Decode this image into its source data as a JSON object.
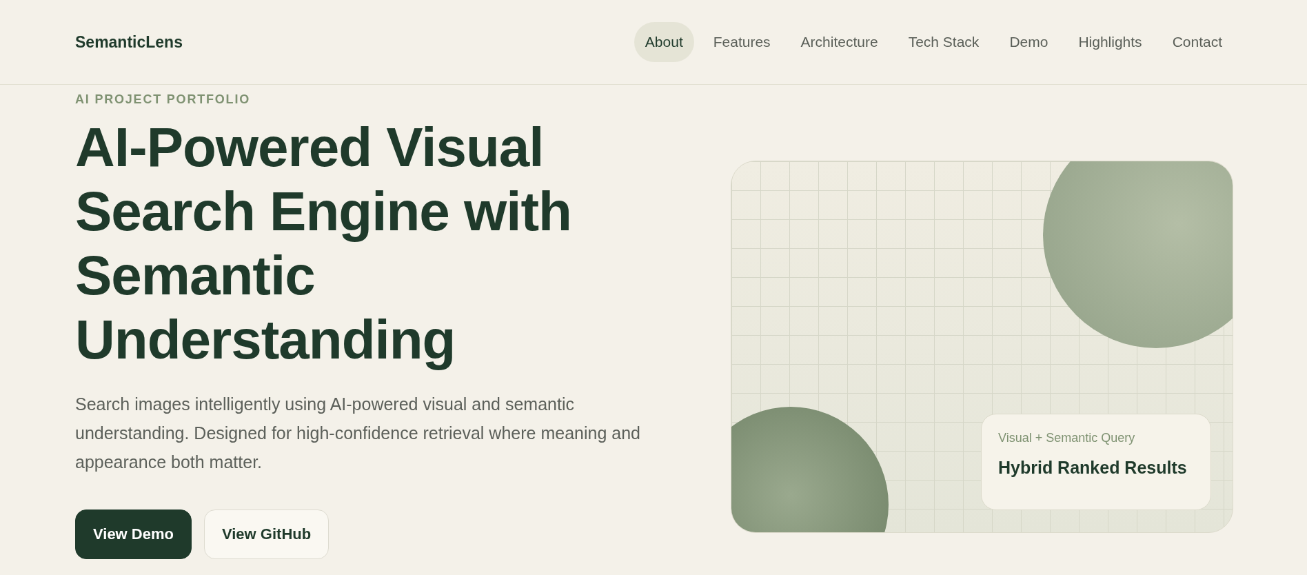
{
  "brand": "SemanticLens",
  "nav": [
    {
      "label": "About",
      "selected": true
    },
    {
      "label": "Features",
      "selected": false
    },
    {
      "label": "Architecture",
      "selected": false
    },
    {
      "label": "Tech Stack",
      "selected": false
    },
    {
      "label": "Demo",
      "selected": false
    },
    {
      "label": "Highlights",
      "selected": false
    },
    {
      "label": "Contact",
      "selected": false
    }
  ],
  "hero": {
    "eyebrow": "AI PROJECT PORTFOLIO",
    "title": "AI-Powered Visual Search Engine with Semantic Understanding",
    "description": "Search images intelligently using AI-powered visual and semantic understanding. Designed for high-confidence retrieval where meaning and appearance both matter.",
    "buttons": [
      {
        "label": "View Demo",
        "kind": "primary"
      },
      {
        "label": "View GitHub",
        "kind": "secondary"
      }
    ]
  },
  "visual_card": {
    "caption": "Visual + Semantic Query",
    "result": "Hybrid Ranked Results"
  }
}
